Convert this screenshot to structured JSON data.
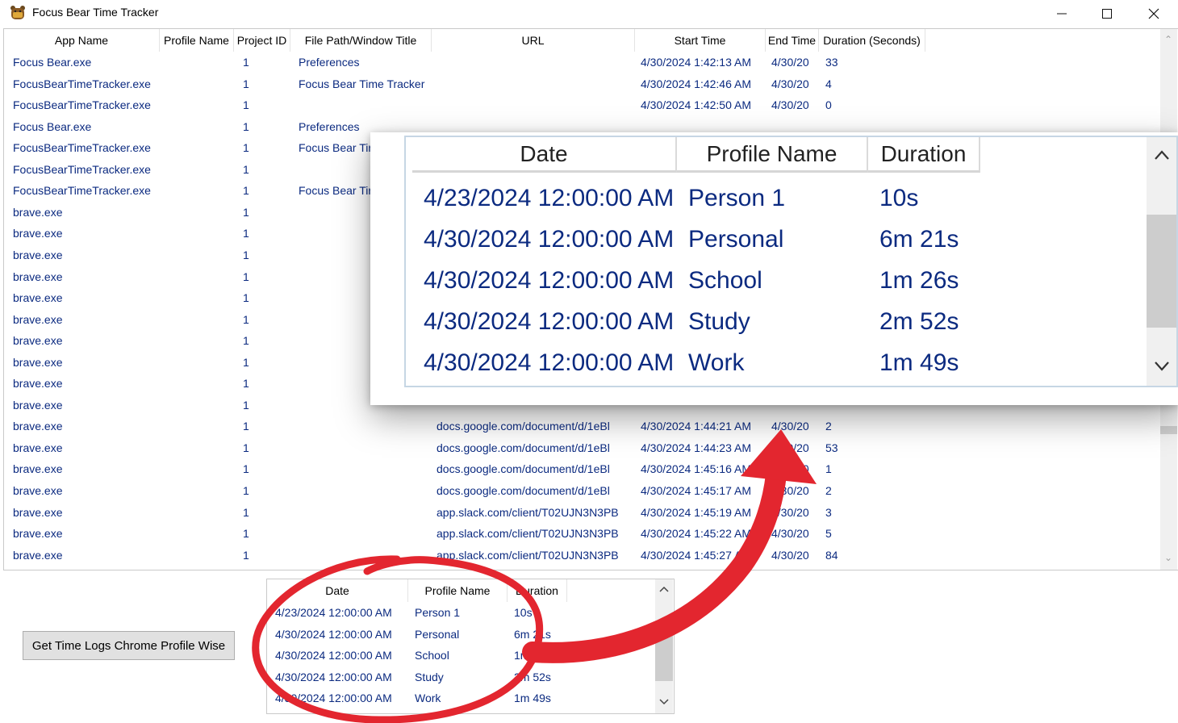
{
  "window": {
    "title": "Focus Bear Time Tracker"
  },
  "main_list": {
    "columns": [
      "App Name",
      "Profile Name",
      "Project ID",
      "File Path/Window Title",
      "URL",
      "Start Time",
      "End Time",
      "Duration (Seconds)"
    ],
    "rows": [
      [
        "Focus Bear.exe",
        "",
        "1",
        "Preferences",
        "",
        "4/30/2024 1:42:13 AM",
        "4/30/20",
        "33"
      ],
      [
        "FocusBearTimeTracker.exe",
        "",
        "1",
        "Focus Bear Time Tracker",
        "",
        "4/30/2024 1:42:46 AM",
        "4/30/20",
        "4"
      ],
      [
        "FocusBearTimeTracker.exe",
        "",
        "1",
        "",
        "",
        "4/30/2024 1:42:50 AM",
        "4/30/20",
        "0"
      ],
      [
        "Focus Bear.exe",
        "",
        "1",
        "Preferences",
        "",
        "",
        "",
        ""
      ],
      [
        "FocusBearTimeTracker.exe",
        "",
        "1",
        "Focus Bear Tir",
        "",
        "",
        "",
        ""
      ],
      [
        "FocusBearTimeTracker.exe",
        "",
        "1",
        "",
        "",
        "",
        "",
        ""
      ],
      [
        "FocusBearTimeTracker.exe",
        "",
        "1",
        "Focus Bear Tir",
        "",
        "",
        "",
        ""
      ],
      [
        "brave.exe",
        "",
        "1",
        "",
        "",
        "",
        "",
        ""
      ],
      [
        "brave.exe",
        "",
        "1",
        "",
        "",
        "",
        "",
        ""
      ],
      [
        "brave.exe",
        "",
        "1",
        "",
        "",
        "",
        "",
        ""
      ],
      [
        "brave.exe",
        "",
        "1",
        "",
        "",
        "",
        "",
        ""
      ],
      [
        "brave.exe",
        "",
        "1",
        "",
        "",
        "",
        "",
        ""
      ],
      [
        "brave.exe",
        "",
        "1",
        "",
        "",
        "",
        "",
        ""
      ],
      [
        "brave.exe",
        "",
        "1",
        "",
        "",
        "",
        "",
        ""
      ],
      [
        "brave.exe",
        "",
        "1",
        "",
        "",
        "",
        "",
        ""
      ],
      [
        "brave.exe",
        "",
        "1",
        "",
        "",
        "",
        "",
        ""
      ],
      [
        "brave.exe",
        "",
        "1",
        "",
        "",
        "",
        "",
        ""
      ],
      [
        "brave.exe",
        "",
        "1",
        "",
        "docs.google.com/document/d/1eBl",
        "4/30/2024 1:44:21 AM",
        "4/30/20",
        "2"
      ],
      [
        "brave.exe",
        "",
        "1",
        "",
        "docs.google.com/document/d/1eBl",
        "4/30/2024 1:44:23 AM",
        "4/30/20",
        "53"
      ],
      [
        "brave.exe",
        "",
        "1",
        "",
        "docs.google.com/document/d/1eBl",
        "4/30/2024 1:45:16 AM",
        "4/30/20",
        "1"
      ],
      [
        "brave.exe",
        "",
        "1",
        "",
        "docs.google.com/document/d/1eBl",
        "4/30/2024 1:45:17 AM",
        "4/30/20",
        "2"
      ],
      [
        "brave.exe",
        "",
        "1",
        "",
        "app.slack.com/client/T02UJN3N3PB",
        "4/30/2024 1:45:19 AM",
        "4/30/20",
        "3"
      ],
      [
        "brave.exe",
        "",
        "1",
        "",
        "app.slack.com/client/T02UJN3N3PB",
        "4/30/2024 1:45:22 AM",
        "4/30/20",
        "5"
      ],
      [
        "brave.exe",
        "",
        "1",
        "",
        "app.slack.com/client/T02UJN3N3PB",
        "4/30/2024 1:45:27 AM",
        "4/30/20",
        "84"
      ]
    ]
  },
  "get_button": {
    "label": "Get Time Logs Chrome Profile Wise"
  },
  "profile_list": {
    "columns": [
      "Date",
      "Profile Name",
      "Duration"
    ],
    "rows": [
      [
        "4/23/2024 12:00:00 AM",
        "Person 1",
        "10s"
      ],
      [
        "4/30/2024 12:00:00 AM",
        "Personal",
        "6m 21s"
      ],
      [
        "4/30/2024 12:00:00 AM",
        "School",
        "1m 26s"
      ],
      [
        "4/30/2024 12:00:00 AM",
        "Study",
        "2m 52s"
      ],
      [
        "4/30/2024 12:00:00 AM",
        "Work",
        "1m 49s"
      ]
    ]
  },
  "colors": {
    "row_text": "#0b2a80",
    "annotation": "#e3262f"
  },
  "icons": [
    "bear-icon",
    "minimize-icon",
    "maximize-icon",
    "close-icon",
    "chevron-up-icon",
    "chevron-down-icon"
  ]
}
